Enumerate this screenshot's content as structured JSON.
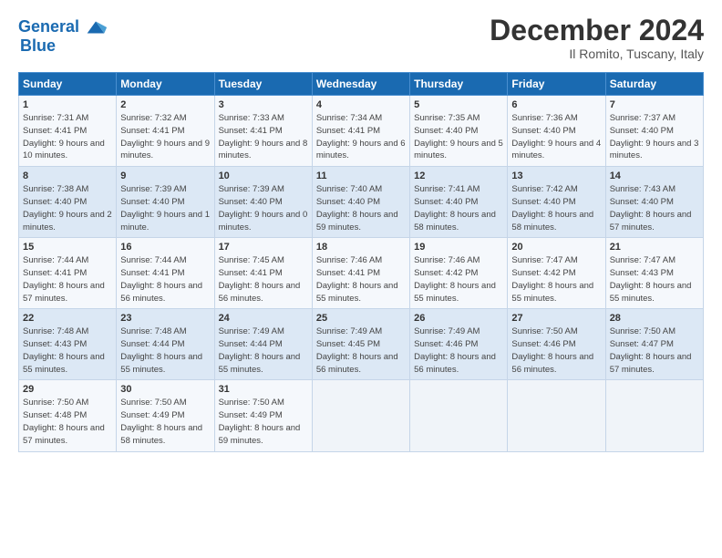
{
  "header": {
    "logo_line1": "General",
    "logo_line2": "Blue",
    "month": "December 2024",
    "location": "Il Romito, Tuscany, Italy"
  },
  "days_of_week": [
    "Sunday",
    "Monday",
    "Tuesday",
    "Wednesday",
    "Thursday",
    "Friday",
    "Saturday"
  ],
  "weeks": [
    [
      {
        "day": "1",
        "sunrise": "Sunrise: 7:31 AM",
        "sunset": "Sunset: 4:41 PM",
        "daylight": "Daylight: 9 hours and 10 minutes."
      },
      {
        "day": "2",
        "sunrise": "Sunrise: 7:32 AM",
        "sunset": "Sunset: 4:41 PM",
        "daylight": "Daylight: 9 hours and 9 minutes."
      },
      {
        "day": "3",
        "sunrise": "Sunrise: 7:33 AM",
        "sunset": "Sunset: 4:41 PM",
        "daylight": "Daylight: 9 hours and 8 minutes."
      },
      {
        "day": "4",
        "sunrise": "Sunrise: 7:34 AM",
        "sunset": "Sunset: 4:41 PM",
        "daylight": "Daylight: 9 hours and 6 minutes."
      },
      {
        "day": "5",
        "sunrise": "Sunrise: 7:35 AM",
        "sunset": "Sunset: 4:40 PM",
        "daylight": "Daylight: 9 hours and 5 minutes."
      },
      {
        "day": "6",
        "sunrise": "Sunrise: 7:36 AM",
        "sunset": "Sunset: 4:40 PM",
        "daylight": "Daylight: 9 hours and 4 minutes."
      },
      {
        "day": "7",
        "sunrise": "Sunrise: 7:37 AM",
        "sunset": "Sunset: 4:40 PM",
        "daylight": "Daylight: 9 hours and 3 minutes."
      }
    ],
    [
      {
        "day": "8",
        "sunrise": "Sunrise: 7:38 AM",
        "sunset": "Sunset: 4:40 PM",
        "daylight": "Daylight: 9 hours and 2 minutes."
      },
      {
        "day": "9",
        "sunrise": "Sunrise: 7:39 AM",
        "sunset": "Sunset: 4:40 PM",
        "daylight": "Daylight: 9 hours and 1 minute."
      },
      {
        "day": "10",
        "sunrise": "Sunrise: 7:39 AM",
        "sunset": "Sunset: 4:40 PM",
        "daylight": "Daylight: 9 hours and 0 minutes."
      },
      {
        "day": "11",
        "sunrise": "Sunrise: 7:40 AM",
        "sunset": "Sunset: 4:40 PM",
        "daylight": "Daylight: 8 hours and 59 minutes."
      },
      {
        "day": "12",
        "sunrise": "Sunrise: 7:41 AM",
        "sunset": "Sunset: 4:40 PM",
        "daylight": "Daylight: 8 hours and 58 minutes."
      },
      {
        "day": "13",
        "sunrise": "Sunrise: 7:42 AM",
        "sunset": "Sunset: 4:40 PM",
        "daylight": "Daylight: 8 hours and 58 minutes."
      },
      {
        "day": "14",
        "sunrise": "Sunrise: 7:43 AM",
        "sunset": "Sunset: 4:40 PM",
        "daylight": "Daylight: 8 hours and 57 minutes."
      }
    ],
    [
      {
        "day": "15",
        "sunrise": "Sunrise: 7:44 AM",
        "sunset": "Sunset: 4:41 PM",
        "daylight": "Daylight: 8 hours and 57 minutes."
      },
      {
        "day": "16",
        "sunrise": "Sunrise: 7:44 AM",
        "sunset": "Sunset: 4:41 PM",
        "daylight": "Daylight: 8 hours and 56 minutes."
      },
      {
        "day": "17",
        "sunrise": "Sunrise: 7:45 AM",
        "sunset": "Sunset: 4:41 PM",
        "daylight": "Daylight: 8 hours and 56 minutes."
      },
      {
        "day": "18",
        "sunrise": "Sunrise: 7:46 AM",
        "sunset": "Sunset: 4:41 PM",
        "daylight": "Daylight: 8 hours and 55 minutes."
      },
      {
        "day": "19",
        "sunrise": "Sunrise: 7:46 AM",
        "sunset": "Sunset: 4:42 PM",
        "daylight": "Daylight: 8 hours and 55 minutes."
      },
      {
        "day": "20",
        "sunrise": "Sunrise: 7:47 AM",
        "sunset": "Sunset: 4:42 PM",
        "daylight": "Daylight: 8 hours and 55 minutes."
      },
      {
        "day": "21",
        "sunrise": "Sunrise: 7:47 AM",
        "sunset": "Sunset: 4:43 PM",
        "daylight": "Daylight: 8 hours and 55 minutes."
      }
    ],
    [
      {
        "day": "22",
        "sunrise": "Sunrise: 7:48 AM",
        "sunset": "Sunset: 4:43 PM",
        "daylight": "Daylight: 8 hours and 55 minutes."
      },
      {
        "day": "23",
        "sunrise": "Sunrise: 7:48 AM",
        "sunset": "Sunset: 4:44 PM",
        "daylight": "Daylight: 8 hours and 55 minutes."
      },
      {
        "day": "24",
        "sunrise": "Sunrise: 7:49 AM",
        "sunset": "Sunset: 4:44 PM",
        "daylight": "Daylight: 8 hours and 55 minutes."
      },
      {
        "day": "25",
        "sunrise": "Sunrise: 7:49 AM",
        "sunset": "Sunset: 4:45 PM",
        "daylight": "Daylight: 8 hours and 56 minutes."
      },
      {
        "day": "26",
        "sunrise": "Sunrise: 7:49 AM",
        "sunset": "Sunset: 4:46 PM",
        "daylight": "Daylight: 8 hours and 56 minutes."
      },
      {
        "day": "27",
        "sunrise": "Sunrise: 7:50 AM",
        "sunset": "Sunset: 4:46 PM",
        "daylight": "Daylight: 8 hours and 56 minutes."
      },
      {
        "day": "28",
        "sunrise": "Sunrise: 7:50 AM",
        "sunset": "Sunset: 4:47 PM",
        "daylight": "Daylight: 8 hours and 57 minutes."
      }
    ],
    [
      {
        "day": "29",
        "sunrise": "Sunrise: 7:50 AM",
        "sunset": "Sunset: 4:48 PM",
        "daylight": "Daylight: 8 hours and 57 minutes."
      },
      {
        "day": "30",
        "sunrise": "Sunrise: 7:50 AM",
        "sunset": "Sunset: 4:49 PM",
        "daylight": "Daylight: 8 hours and 58 minutes."
      },
      {
        "day": "31",
        "sunrise": "Sunrise: 7:50 AM",
        "sunset": "Sunset: 4:49 PM",
        "daylight": "Daylight: 8 hours and 59 minutes."
      },
      null,
      null,
      null,
      null
    ]
  ]
}
